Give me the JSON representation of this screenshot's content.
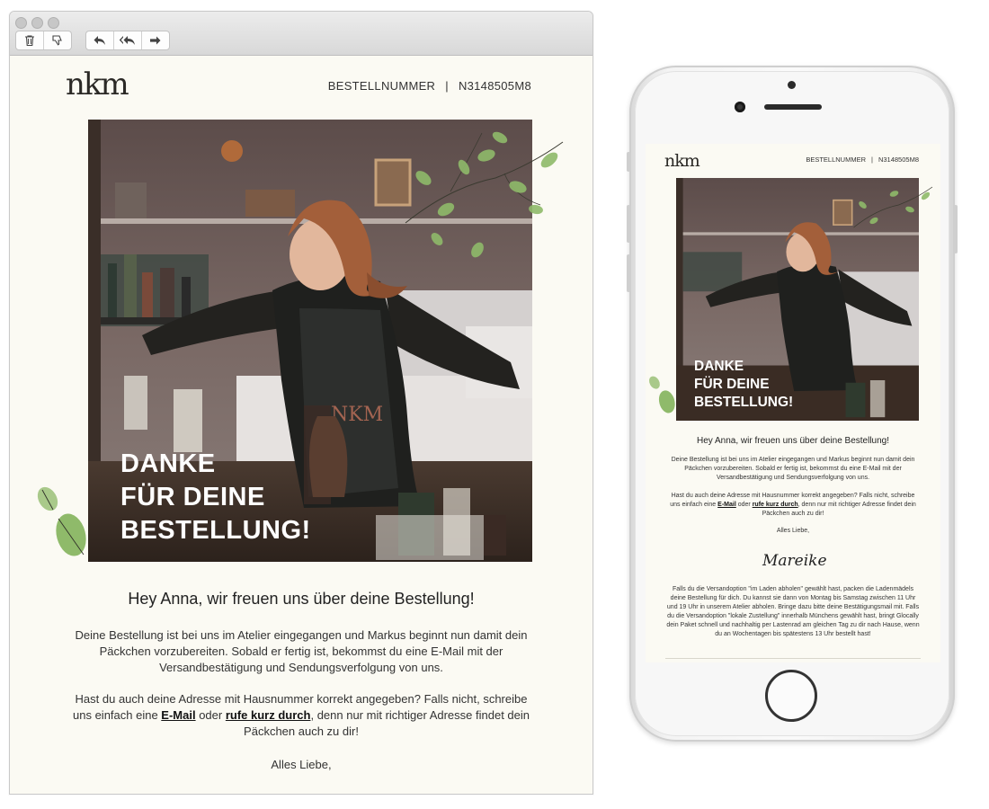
{
  "desktop": {
    "toolbar": {
      "buttons": [
        {
          "icon": "trash-icon"
        },
        {
          "icon": "thumbs-down-icon"
        },
        {
          "icon": "reply-icon"
        },
        {
          "icon": "reply-all-icon"
        },
        {
          "icon": "forward-icon"
        }
      ]
    },
    "email": {
      "logo": "nkm",
      "order_label": "BESTELLNUMMER",
      "order_separator": "|",
      "order_number": "N3148505M8",
      "hero_lines": [
        "DANKE",
        "FÜR DEINE",
        "BESTELLUNG!"
      ],
      "greeting": "Hey Anna, wir freuen uns über deine Bestellung!",
      "paragraph1": "Deine Bestellung ist bei uns im Atelier eingegangen und Markus beginnt nun damit dein Päckchen vorzubereiten. Sobald er fertig ist, bekommst du eine E-Mail mit der Versandbestätigung und Sendungsverfolgung von uns.",
      "paragraph2_pre": "Hast du auch deine Adresse mit Hausnummer korrekt angegeben? Falls nicht, schreibe uns einfach eine ",
      "link_email": "E-Mail",
      "paragraph2_mid": " oder ",
      "link_call": "rufe kurz durch",
      "paragraph2_post": ", denn nur mit richtiger Adresse findet dein Päckchen auch zu dir!",
      "closing": "Alles Liebe,"
    }
  },
  "mobile": {
    "email": {
      "logo": "nkm",
      "order_label": "BESTELLNUMMER",
      "order_separator": "|",
      "order_number": "N3148505M8",
      "hero_lines": [
        "DANKE",
        "FÜR DEINE",
        "BESTELLUNG!"
      ],
      "greeting": "Hey Anna, wir freuen uns über deine Bestellung!",
      "paragraph1": "Deine Bestellung ist bei uns im Atelier eingegangen und Markus beginnt nun damit dein Päckchen vorzubereiten. Sobald er fertig ist, bekommst du eine E-Mail mit der Versandbestätigung und Sendungsverfolgung von uns.",
      "paragraph2_pre": "Hast du auch deine Adresse mit Hausnummer korrekt angegeben? Falls nicht, schreibe uns einfach eine ",
      "link_email": "E-Mail",
      "paragraph2_mid": " oder ",
      "link_call": "rufe kurz durch",
      "paragraph2_post": ", denn nur mit richtiger Adresse findet dein Päckchen auch zu dir!",
      "closing": "Alles Liebe,",
      "signature": "Mareike",
      "paragraph3": "Falls du die Versandoption \"im Laden abholen\" gewählt hast, packen die Ladenmädels deine Bestellung für dich. Du kannst sie dann von Montag bis Samstag zwischen 11 Uhr und 19 Uhr in unserem Atelier abholen. Bringe dazu bitte deine Bestätigungsmail mit. Falls du die Versandoption \"lokale Zustellung\" innerhalb Münchens gewählt hast, bringt Glocally dein Paket schnell und nachhaltig per Lastenrad am gleichen Tag zu dir nach Hause, wenn du an Wochentagen bis spätestens 13 Uhr bestellt hast!"
    }
  },
  "colors": {
    "paper": "#fbfaf3",
    "leaf_green": "#8fba6a",
    "photo_wall": "#6e5a55",
    "apron": "#2a2c2b"
  }
}
